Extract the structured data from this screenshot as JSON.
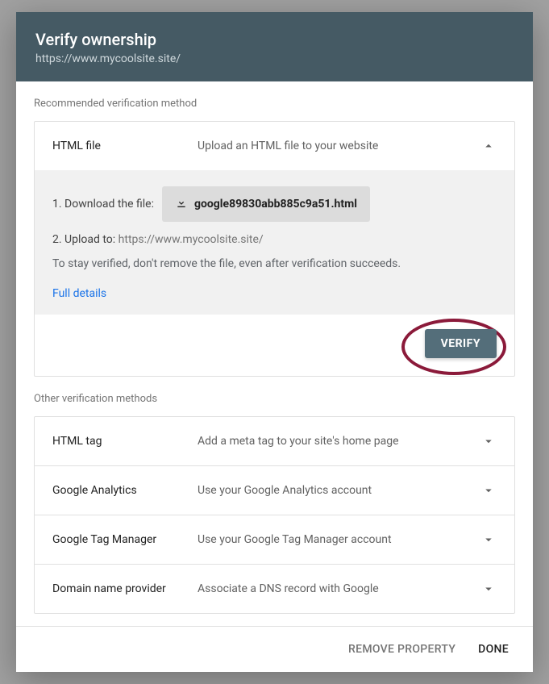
{
  "header": {
    "title": "Verify ownership",
    "subtitle": "https://www.mycoolsite.site/"
  },
  "recommended": {
    "section_label": "Recommended verification method",
    "method_name": "HTML file",
    "method_desc": "Upload an HTML file to your website",
    "step1_label": "1. Download the file:",
    "download_filename": "google89830abb885c9a51.html",
    "step2_label": "2. Upload to:",
    "upload_url": "https://www.mycoolsite.site/",
    "note": "To stay verified, don't remove the file, even after verification succeeds.",
    "full_details": "Full details",
    "verify_label": "VERIFY"
  },
  "other": {
    "section_label": "Other verification methods",
    "methods": [
      {
        "name": "HTML tag",
        "desc": "Add a meta tag to your site's home page"
      },
      {
        "name": "Google Analytics",
        "desc": "Use your Google Analytics account"
      },
      {
        "name": "Google Tag Manager",
        "desc": "Use your Google Tag Manager account"
      },
      {
        "name": "Domain name provider",
        "desc": "Associate a DNS record with Google"
      }
    ]
  },
  "footer": {
    "remove": "REMOVE PROPERTY",
    "done": "DONE"
  }
}
